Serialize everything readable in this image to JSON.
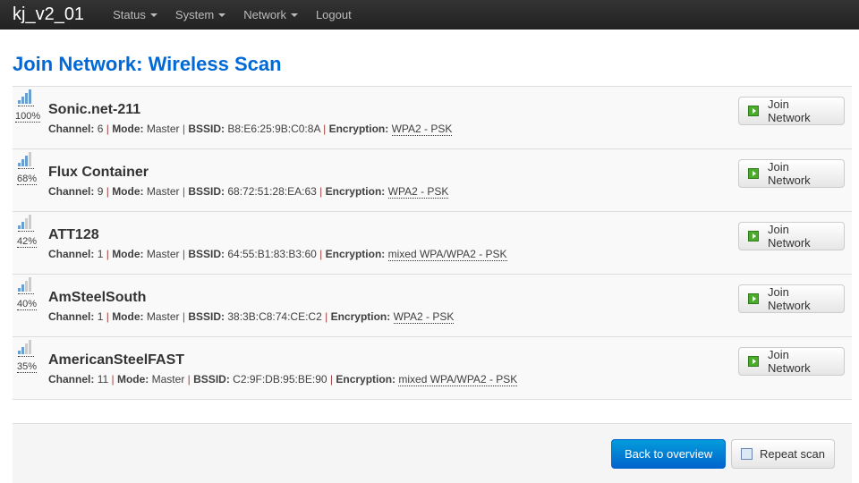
{
  "nav": {
    "brand": "kj_v2_01",
    "items": [
      "Status",
      "System",
      "Network",
      "Logout"
    ]
  },
  "title": "Join Network: Wireless Scan",
  "labels": {
    "channel": "Channel:",
    "mode": "Mode:",
    "bssid": "BSSID:",
    "encryption": "Encryption:",
    "join": "Join Network",
    "sep": "|"
  },
  "networks": [
    {
      "ssid": "Sonic.net-211",
      "signal": "100%",
      "level": 4,
      "channel": "6",
      "mode": "Master",
      "bssid": "B8:E6:25:9B:C0:8A",
      "encryption": "WPA2 - PSK"
    },
    {
      "ssid": "Flux Container",
      "signal": "68%",
      "level": 3,
      "channel": "9",
      "mode": "Master",
      "bssid": "68:72:51:28:EA:63",
      "encryption": "WPA2 - PSK"
    },
    {
      "ssid": "ATT128",
      "signal": "42%",
      "level": 2,
      "channel": "1",
      "mode": "Master",
      "bssid": "64:55:B1:83:B3:60",
      "encryption": "mixed WPA/WPA2 - PSK"
    },
    {
      "ssid": "AmSteelSouth",
      "signal": "40%",
      "level": 2,
      "channel": "1",
      "mode": "Master",
      "bssid": "38:3B:C8:74:CE:C2",
      "encryption": "WPA2 - PSK"
    },
    {
      "ssid": "AmericanSteelFAST",
      "signal": "35%",
      "level": 2,
      "channel": "11",
      "mode": "Master",
      "bssid": "C2:9F:DB:95:BE:90",
      "encryption": "mixed WPA/WPA2 - PSK"
    }
  ],
  "footer": {
    "back": "Back to overview",
    "repeat": "Repeat scan"
  }
}
